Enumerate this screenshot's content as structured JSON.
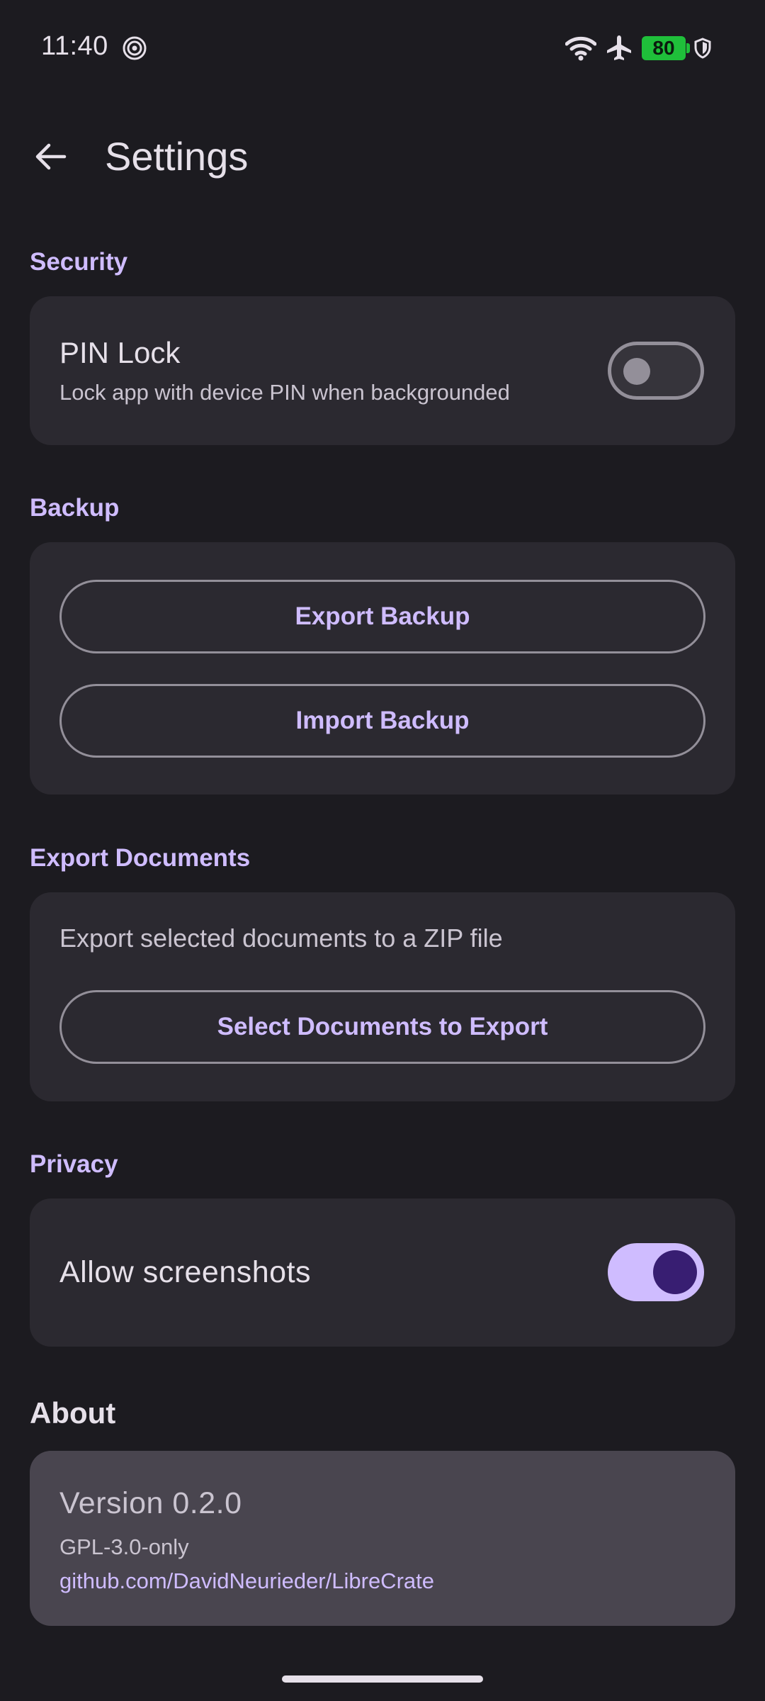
{
  "status_bar": {
    "time": "11:40",
    "battery_level": "80",
    "icons": [
      "spiral-icon",
      "wifi-icon",
      "airplane-icon",
      "battery-icon",
      "shield-icon"
    ]
  },
  "app_bar": {
    "title": "Settings",
    "back_icon": "arrow-left-icon"
  },
  "security": {
    "header": "Security",
    "pin_lock": {
      "title": "PIN Lock",
      "description": "Lock app with device PIN when backgrounded",
      "enabled": false
    }
  },
  "backup": {
    "header": "Backup",
    "export_label": "Export Backup",
    "import_label": "Import Backup"
  },
  "export_documents": {
    "header": "Export Documents",
    "description": "Export selected documents to a ZIP file",
    "select_label": "Select Documents to Export"
  },
  "privacy": {
    "header": "Privacy",
    "allow_screenshots": {
      "label": "Allow screenshots",
      "enabled": true
    }
  },
  "about": {
    "header": "About",
    "version": "Version 0.2.0",
    "license": "GPL-3.0-only",
    "link": "github.com/DavidNeurieder/LibreCrate"
  },
  "colors": {
    "background": "#1c1b20",
    "surface": "#2b2930",
    "surface_high": "#49454f",
    "accent": "#cfbcff",
    "on_accent": "#381e72",
    "outline": "#938f99",
    "battery": "#1fbf3a"
  }
}
